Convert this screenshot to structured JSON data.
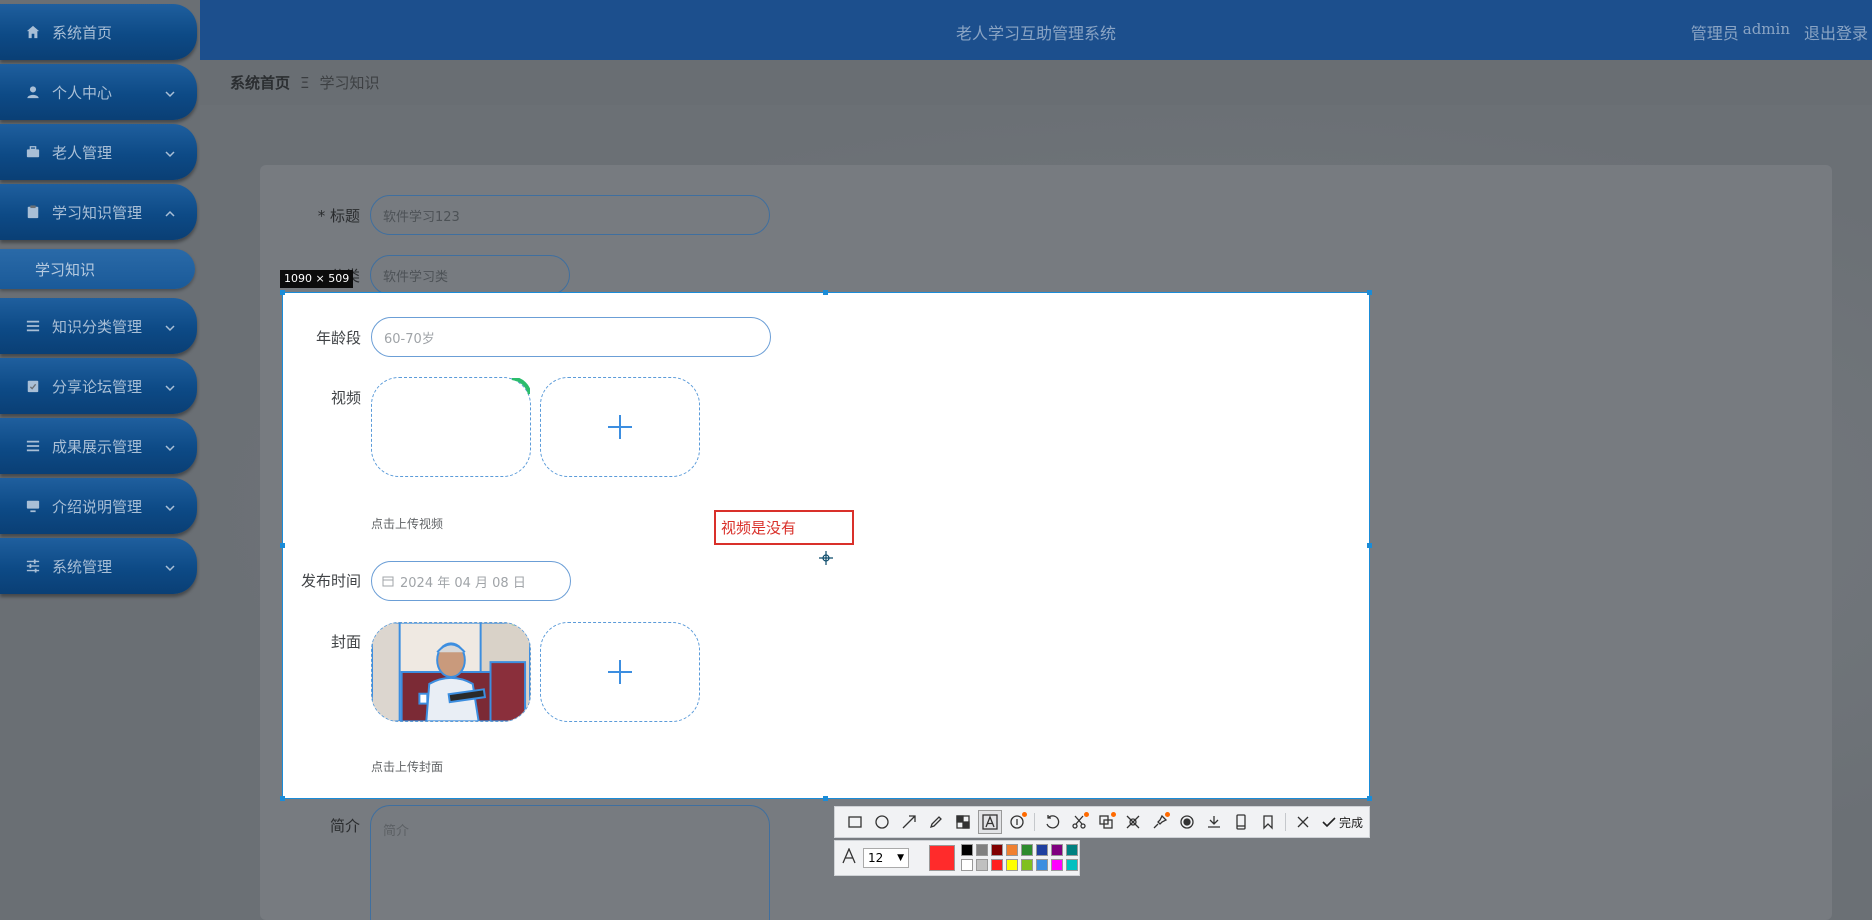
{
  "sidebar": {
    "items": [
      {
        "label": "系统首页",
        "icon": "home-icon"
      },
      {
        "label": "个人中心",
        "icon": "user-icon"
      },
      {
        "label": "老人管理",
        "icon": "briefcase-icon"
      },
      {
        "label": "学习知识管理",
        "icon": "clipboard-icon"
      },
      {
        "label": "知识分类管理",
        "icon": "list-icon"
      },
      {
        "label": "分享论坛管理",
        "icon": "clipboard-check-icon"
      },
      {
        "label": "成果展示管理",
        "icon": "list-icon"
      },
      {
        "label": "介绍说明管理",
        "icon": "monitor-icon"
      },
      {
        "label": "系统管理",
        "icon": "sliders-icon"
      }
    ],
    "sub_item": "学习知识"
  },
  "header": {
    "title": "老人学习互助管理系统",
    "role": "管理员",
    "username": "admin",
    "logout": "退出登录"
  },
  "breadcrumb": {
    "home": "系统首页",
    "separator": "Ξ",
    "current": "学习知识"
  },
  "form": {
    "title_label": "* 标题",
    "title_value": "软件学习123",
    "category_label": "分类",
    "category_value": "软件学习类",
    "age_label": "年龄段",
    "age_value": "60-70岁",
    "video_label": "视频",
    "video_hint": "点击上传视频",
    "date_label": "发布时间",
    "date_value": "2024 年 04 月 08 日",
    "cover_label": "封面",
    "cover_hint": "点击上传封面",
    "intro_label": "简介",
    "intro_placeholder": "简介"
  },
  "capture": {
    "size_label": "1090 × 509",
    "annotation": "视频是没有",
    "done_label": "完成",
    "font_size": "12",
    "current_color": "#ff2b2b",
    "palette": [
      "#000000",
      "#808080",
      "#800000",
      "#f08030",
      "#2e8b2e",
      "#1f3f9f",
      "#7f007f",
      "#008080",
      "#ffffff",
      "#c0c0c0",
      "#ff2020",
      "#ffff00",
      "#80c020",
      "#3c8ee0",
      "#ff00ff",
      "#00c0c0"
    ]
  }
}
